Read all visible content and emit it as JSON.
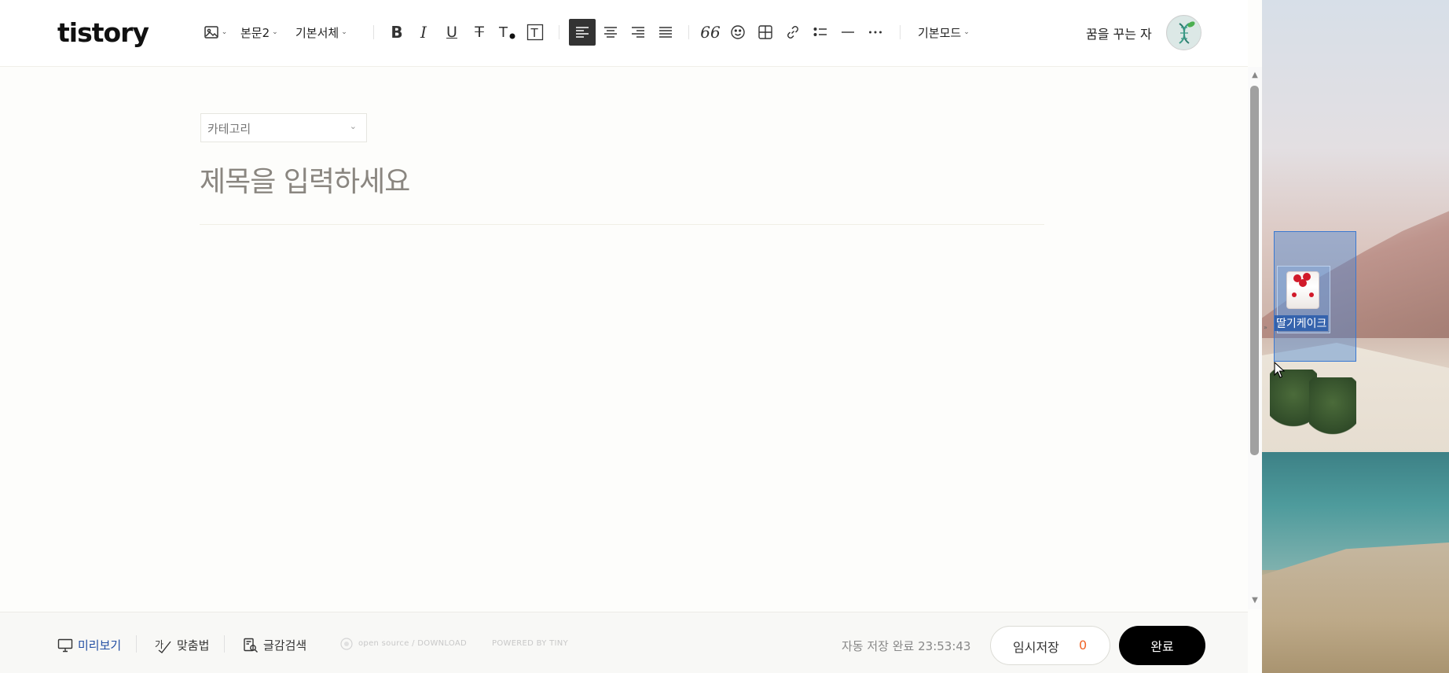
{
  "app": {
    "logo": "tistory",
    "user_name": "꿈을 꾸는 자"
  },
  "toolbar": {
    "paragraph_style": "본문2",
    "font_family": "기본서체",
    "mode": "기본모드",
    "icons": [
      "image-icon",
      "bold-icon",
      "italic-icon",
      "underline-icon",
      "strikethrough-icon",
      "text-color-icon",
      "text-background-icon",
      "align-left-icon",
      "align-center-icon",
      "align-right-icon",
      "align-justify-icon",
      "quote-icon",
      "emoji-icon",
      "table-icon",
      "link-icon",
      "list-icon",
      "divider-icon",
      "more-icon"
    ],
    "bold": "B",
    "italic": "I",
    "underline": "U",
    "strike": "T",
    "quote": "66"
  },
  "editor": {
    "category_placeholder": "카테고리",
    "title_placeholder": "제목을 입력하세요"
  },
  "bottom": {
    "preview": "미리보기",
    "spelling": "맞춤법",
    "search": "글감검색",
    "open_source": "open source / DOWNLOAD",
    "powered_by": "POWERED BY TINY",
    "autosave": "자동 저장 완료 23:53:43",
    "draft_label": "임시저장",
    "draft_count": "0",
    "done_label": "완료"
  },
  "desktop": {
    "icon_label": "딸기케이크"
  },
  "colors": {
    "accent_orange": "#f06428",
    "done_bg": "#000000",
    "selection_blue": "#3a78d0"
  }
}
